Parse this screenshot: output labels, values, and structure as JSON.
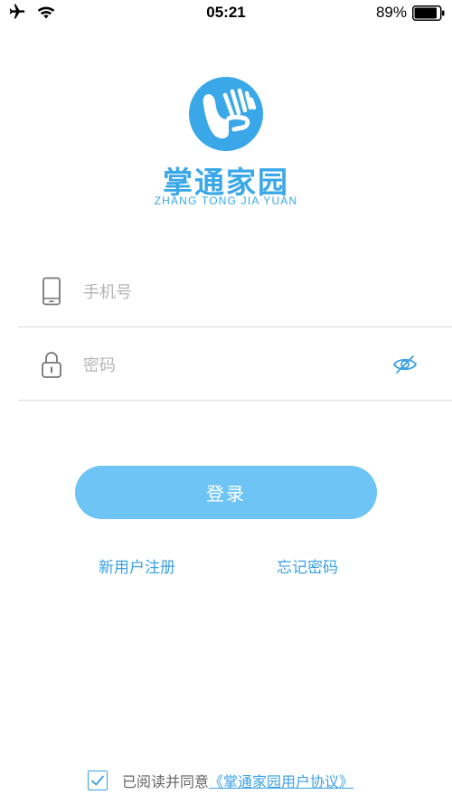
{
  "status_bar": {
    "time": "05:21",
    "battery": "89%",
    "battery_level": 0.89,
    "icons": [
      "airplane-icon",
      "wifi-icon",
      "battery-icon"
    ]
  },
  "brand": {
    "name_cn": "掌通家园",
    "name_en": "ZHANG TONG JIA YUAN",
    "color": "#3aa8e8"
  },
  "form": {
    "phone": {
      "placeholder": "手机号",
      "value": ""
    },
    "password": {
      "placeholder": "密码",
      "value": ""
    }
  },
  "actions": {
    "login_label": "登录",
    "register_label": "新用户注册",
    "forgot_label": "忘记密码"
  },
  "agreement": {
    "checked": true,
    "text": "已阅读并同意",
    "link": "《掌通家园用户协议》"
  },
  "colors": {
    "accent": "#3aa0e4",
    "button": "#6ec4f4"
  }
}
